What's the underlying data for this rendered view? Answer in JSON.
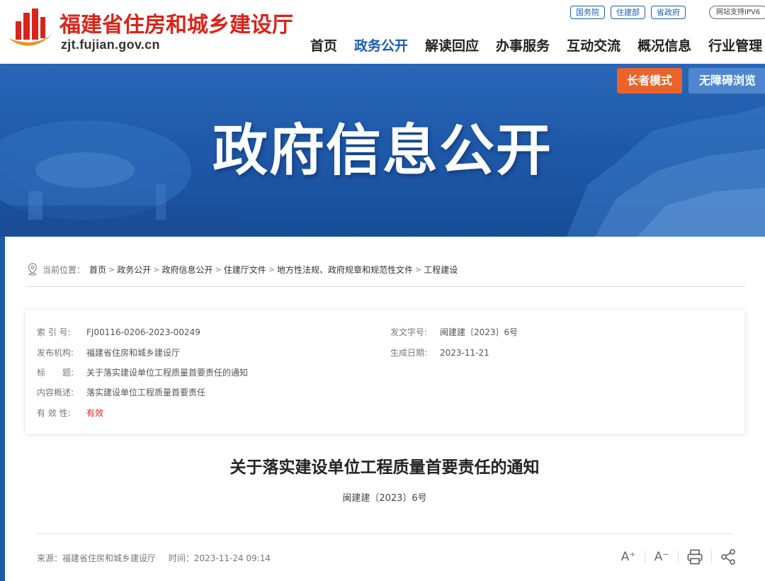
{
  "header": {
    "site_name": "福建省住房和城乡建设厅",
    "domain": "zjt.fujian.gov.cn",
    "top_links": [
      "国务院",
      "住建部",
      "省政府"
    ],
    "ipv6_label": "网站支持IPV6",
    "nav": [
      "首页",
      "政务公开",
      "解读回应",
      "办事服务",
      "互动交流",
      "概况信息",
      "行业管理"
    ],
    "active_nav": "政务公开",
    "logo_colors": {
      "pillars": "#d9241b",
      "arc": "#e8942a"
    }
  },
  "banner": {
    "title": "政府信息公开",
    "elder_mode": "长者模式",
    "accessible": "无障碍浏览"
  },
  "breadcrumb": {
    "label": "当前位置：",
    "items": [
      "首页",
      "政务公开",
      "政府信息公开",
      "住建厅文件",
      "地方性法规、政府规章和规范性文件",
      "工程建设"
    ],
    "separator": ">"
  },
  "info": {
    "index_label": "索 引 号:",
    "index_value": "FJ00116-0206-2023-00249",
    "doc_no_label": "发文字号:",
    "doc_no_value": "闽建建〔2023〕6号",
    "publisher_label": "发布机构:",
    "publisher_value": "福建省住房和城乡建设厅",
    "date_label": "生成日期:",
    "date_value": "2023-11-21",
    "title_label": "标　　题:",
    "title_value": "关于落实建设单位工程质量首要责任的通知",
    "summary_label": "内容概述:",
    "summary_value": "落实建设单位工程质量首要责任",
    "validity_label": "有 效 性:",
    "validity_value": "有效"
  },
  "article": {
    "title": "关于落实建设单位工程质量首要责任的通知",
    "doc_no": "闽建建〔2023〕6号",
    "source": "来源：福建省住房和城乡建设厅",
    "time": "时间：2023-11-24 09:14"
  },
  "tools": {
    "font_increase": "A⁺",
    "font_decrease": "A⁻"
  },
  "colors": {
    "brand_red": "#d9241b",
    "brand_blue": "#1a5bb3",
    "banner_blue": "#1f5aaa",
    "elder_orange": "#e9632b",
    "access_blue": "#4f87cf",
    "valid_red": "#e0201b"
  }
}
